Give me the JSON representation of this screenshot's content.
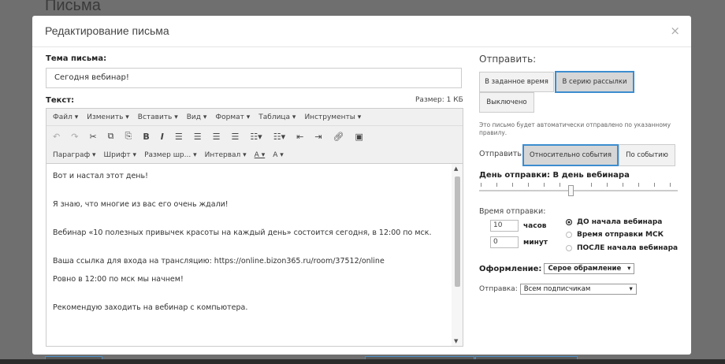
{
  "background": {
    "page_title": "Письма"
  },
  "modal": {
    "title": "Редактирование письма",
    "close": "×"
  },
  "subject": {
    "label": "Тема письма:",
    "value": "Сегодня вебинар!"
  },
  "text": {
    "label": "Текст:",
    "size": "Размер: 1 КБ"
  },
  "editor": {
    "menu": [
      "Файл ▾",
      "Изменить ▾",
      "Вставить ▾",
      "Вид ▾",
      "Формат ▾",
      "Таблица ▾",
      "Инструменты ▾"
    ],
    "toolbar2": [
      "Параграф  ▾",
      "Шрифт        ▾",
      "Размер шр...  ▾",
      "Интервал ▾",
      "A ▾",
      "A ▾"
    ],
    "content": {
      "line1": "Вот и настал этот день!",
      "line2": "Я знаю, что многие из вас его очень ждали!",
      "line3": "Вебинар «10 полезных привычек красоты на каждый день» состоится сегодня, в 12:00 по мск.",
      "line4": "Ваша ссылка для входа на трансляцию: https://online.bizon365.ru/room/37512/online",
      "line5": "Ровно в 12:00 по мск мы начнем!",
      "line6": "Рекомендую заходить на вебинар с компьютера."
    }
  },
  "send": {
    "title": "Отправить:",
    "btn_scheduled": "В заданное время",
    "btn_series": "В серию рассылки",
    "btn_off": "Выключено",
    "note": "Это письмо будет автоматически отправлено по указанному правилу.",
    "send_label": "Отправить:",
    "btn_relative": "Относительно события",
    "btn_event": "По событию",
    "day_label": "День отправки:  В день вебинара",
    "time_label": "Время отправки:",
    "hours_value": "10",
    "hours_unit": "часов",
    "minutes_value": "0",
    "minutes_unit": "минут",
    "radio_before": "ДО начала вебинара",
    "radio_msk": "Время отправки МСК",
    "radio_after": "ПОСЛЕ начала вебинара",
    "design_label": "Оформление:",
    "design_value": "Серое обрамление",
    "dispatch_label": "Отправка:",
    "dispatch_value": "Всем подписчикам"
  }
}
